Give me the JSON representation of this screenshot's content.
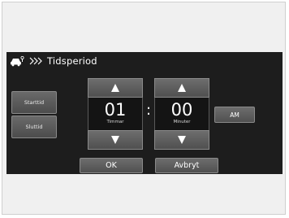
{
  "header": {
    "icon": "car-settings-icon",
    "chevrons": ">>>",
    "title": "Tidsperiod"
  },
  "side_buttons": {
    "start_label": "Starttid",
    "end_label": "Sluttid"
  },
  "hours": {
    "value": "01",
    "unit_label": "Timmar"
  },
  "minutes": {
    "value": "00",
    "unit_label": "Minuter"
  },
  "separator": ":",
  "ampm_label": "AM",
  "footer": {
    "ok_label": "OK",
    "cancel_label": "Avbryt"
  },
  "colors": {
    "screen_background": "#1d1d1d",
    "button_gradient_top": "#6d6d6d",
    "button_gradient_bottom": "#505050",
    "text": "#ffffff"
  }
}
